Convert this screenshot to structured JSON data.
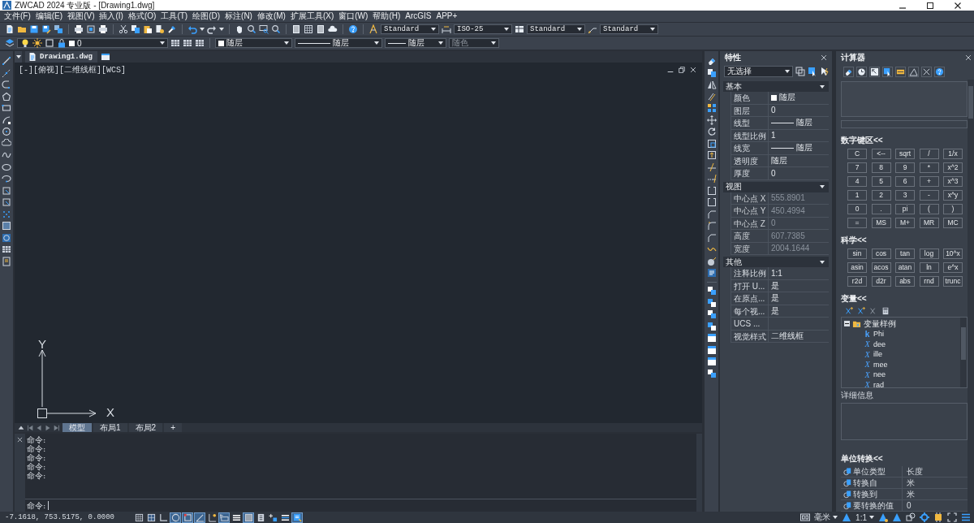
{
  "window": {
    "title": "ZWCAD 2024 专业版 - [Drawing1.dwg]"
  },
  "menu": [
    "文件(F)",
    "编辑(E)",
    "视图(V)",
    "插入(I)",
    "格式(O)",
    "工具(T)",
    "绘图(D)",
    "标注(N)",
    "修改(M)",
    "扩展工具(X)",
    "窗口(W)",
    "帮助(H)",
    "ArcGIS",
    "APP+"
  ],
  "style_toolbar": [
    {
      "kind": "text",
      "value": "Standard"
    },
    {
      "kind": "dimension",
      "value": "ISO-25"
    },
    {
      "kind": "table",
      "value": "Standard"
    },
    {
      "kind": "multileader",
      "value": "Standard"
    }
  ],
  "layer_toolbar": {
    "layer": "0",
    "properties": [
      {
        "kind": "color",
        "value": "随层"
      },
      {
        "kind": "linetype",
        "value": "随层"
      },
      {
        "kind": "lineweight",
        "value": "随层"
      },
      {
        "kind": "plotstyle",
        "value": "随色"
      }
    ]
  },
  "drawing_tabs": [
    {
      "label": "Drawing1.dwg",
      "selected": true
    }
  ],
  "viewport": {
    "label": "[-][俯视][二维线框][WCS]",
    "axis_x": "X",
    "axis_y": "Y"
  },
  "layout_tabs": [
    {
      "label": "模型",
      "selected": true
    },
    {
      "label": "布局1",
      "selected": false
    },
    {
      "label": "布局2",
      "selected": false
    },
    {
      "label": "+",
      "selected": false
    }
  ],
  "command_line": {
    "history": [
      "命令:",
      "命令:",
      "命令:",
      "命令:",
      "命令:"
    ],
    "prompt": "命令:"
  },
  "properties": {
    "title": "特性",
    "selection": "无选择",
    "sections": [
      {
        "title": "基本",
        "expanded": true,
        "rows": [
          {
            "label": "颜色",
            "value": "随层",
            "kind": "color",
            "disabled": false
          },
          {
            "label": "图层",
            "value": "0",
            "kind": "text",
            "disabled": false
          },
          {
            "label": "线型",
            "value": "随层",
            "kind": "line",
            "disabled": false
          },
          {
            "label": "线型比例",
            "value": "1",
            "kind": "text",
            "disabled": false
          },
          {
            "label": "线宽",
            "value": "随层",
            "kind": "line",
            "disabled": false
          },
          {
            "label": "透明度",
            "value": "随层",
            "kind": "text",
            "disabled": false
          },
          {
            "label": "厚度",
            "value": "0",
            "kind": "text",
            "disabled": false
          }
        ]
      },
      {
        "title": "视图",
        "expanded": true,
        "rows": [
          {
            "label": "中心点 X",
            "value": "555.8901",
            "kind": "text",
            "disabled": true
          },
          {
            "label": "中心点 Y",
            "value": "450.4994",
            "kind": "text",
            "disabled": true
          },
          {
            "label": "中心点 Z",
            "value": "0",
            "kind": "text",
            "disabled": true
          },
          {
            "label": "高度",
            "value": "607.7385",
            "kind": "text",
            "disabled": true
          },
          {
            "label": "宽度",
            "value": "2004.1644",
            "kind": "text",
            "disabled": true
          }
        ]
      },
      {
        "title": "其他",
        "expanded": true,
        "rows": [
          {
            "label": "注释比例",
            "value": "1:1",
            "kind": "text",
            "disabled": false
          },
          {
            "label": "打开 U...",
            "value": "是",
            "kind": "text",
            "disabled": false
          },
          {
            "label": "在原点...",
            "value": "是",
            "kind": "text",
            "disabled": false
          },
          {
            "label": "每个视...",
            "value": "是",
            "kind": "text",
            "disabled": false
          },
          {
            "label": "UCS ...",
            "kind": "text",
            "disabled": false
          },
          {
            "label": "视觉样式",
            "value": "二维线框",
            "kind": "text",
            "disabled": false
          }
        ]
      }
    ]
  },
  "calculator": {
    "title": "计算器",
    "keypad": {
      "title": "数字键区<<",
      "keys": [
        "C",
        "<--",
        "sqrt",
        "/",
        "1/x",
        "7",
        "8",
        "9",
        "*",
        "x^2",
        "4",
        "5",
        "6",
        "+",
        "x^3",
        "1",
        "2",
        "3",
        "-",
        "x^y",
        "0",
        ".",
        "pi",
        "(",
        ")",
        "=",
        "MS",
        "M+",
        "MR",
        "MC"
      ]
    },
    "scientific": {
      "title": "科学<<",
      "keys": [
        "sin",
        "cos",
        "tan",
        "log",
        "10^x",
        "asin",
        "acos",
        "atan",
        "ln",
        "e^x",
        "r2d",
        "d2r",
        "abs",
        "rnd",
        "trunc"
      ]
    },
    "variables": {
      "title": "变量<<",
      "tree": [
        {
          "label": "变量样例",
          "expanded": true,
          "children": [
            {
              "kind": "constant",
              "glyph": "k",
              "label": "Phi"
            },
            {
              "kind": "variable",
              "glyph": "X",
              "label": "dee"
            },
            {
              "kind": "variable",
              "glyph": "X",
              "label": "ille"
            },
            {
              "kind": "variable",
              "glyph": "X",
              "label": "mee"
            },
            {
              "kind": "variable",
              "glyph": "X",
              "label": "nee"
            },
            {
              "kind": "variable",
              "glyph": "X",
              "label": "rad"
            }
          ]
        }
      ]
    },
    "details_label": "详细信息",
    "units": {
      "title": "单位转换<<",
      "rows": [
        {
          "label": "单位类型",
          "value": "长度"
        },
        {
          "label": "转换自",
          "value": "米"
        },
        {
          "label": "转换到",
          "value": "米"
        },
        {
          "label": "要转换的值",
          "value": "0"
        }
      ]
    }
  },
  "status_bar": {
    "coordinates": "-7.1618, 753.5175, 0.0000",
    "toggles": [
      {
        "on": false
      },
      {
        "on": false
      },
      {
        "on": false
      },
      {
        "on": true
      },
      {
        "on": true
      },
      {
        "on": true
      },
      {
        "on": false
      },
      {
        "on": true
      },
      {
        "on": false
      },
      {
        "on": true
      },
      {
        "on": false
      },
      {
        "on": false
      },
      {
        "on": false
      },
      {
        "on": true
      }
    ],
    "units": "毫米",
    "scale": "1:1"
  }
}
